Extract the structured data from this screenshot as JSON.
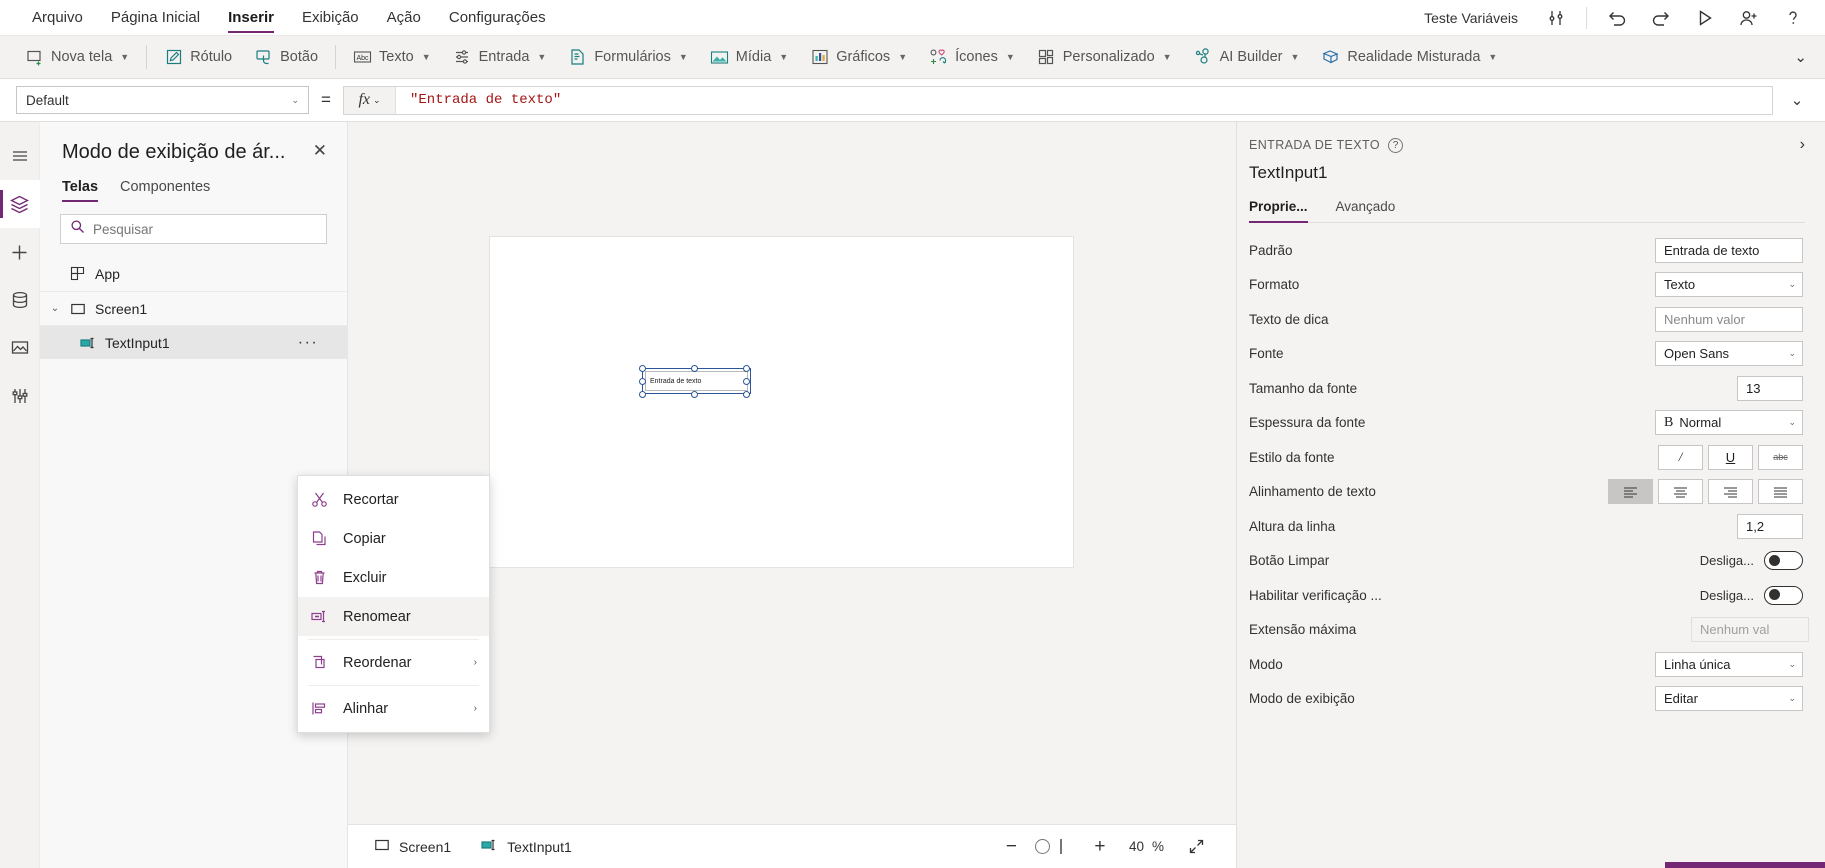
{
  "menubar": {
    "items": [
      {
        "label": "Arquivo",
        "active": false
      },
      {
        "label": "Página Inicial",
        "active": false
      },
      {
        "label": "Inserir",
        "active": true
      },
      {
        "label": "Exibição",
        "active": false
      },
      {
        "label": "Ação",
        "active": false
      },
      {
        "label": "Configurações",
        "active": false
      }
    ],
    "variables_test": "Teste Variáveis",
    "icons": [
      "settings-sliders-icon",
      "undo-icon",
      "redo-icon",
      "play-icon",
      "share-user-icon",
      "help-icon"
    ]
  },
  "ribbon": {
    "items": [
      {
        "label": "Nova tela",
        "icon": "new-screen-icon",
        "caret": true
      },
      {
        "label": "Rótulo",
        "icon": "label-icon",
        "caret": false
      },
      {
        "label": "Botão",
        "icon": "button-icon",
        "caret": false
      },
      {
        "label": "Texto",
        "icon": "text-abc-icon",
        "caret": true
      },
      {
        "label": "Entrada",
        "icon": "input-sliders-icon",
        "caret": true
      },
      {
        "label": "Formulários",
        "icon": "forms-icon",
        "caret": true
      },
      {
        "label": "Mídia",
        "icon": "media-image-icon",
        "caret": true
      },
      {
        "label": "Gráficos",
        "icon": "charts-bar-icon",
        "caret": true
      },
      {
        "label": "Ícones",
        "icon": "icons-shapes-icon",
        "caret": true
      },
      {
        "label": "Personalizado",
        "icon": "custom-grid-icon",
        "caret": true
      },
      {
        "label": "AI Builder",
        "icon": "ai-builder-icon",
        "caret": true
      },
      {
        "label": "Realidade Misturada",
        "icon": "mixed-reality-icon",
        "caret": true
      }
    ],
    "overflow": "chevron-down-icon"
  },
  "formulabar": {
    "property": "Default",
    "equals": "=",
    "fx_label": "fx",
    "formula": "\"Entrada de texto\""
  },
  "rail": {
    "items": [
      {
        "icon": "hamburger-menu-icon",
        "selected": false
      },
      {
        "icon": "tree-view-layers-icon",
        "selected": true
      },
      {
        "icon": "insert-plus-icon",
        "selected": false
      },
      {
        "icon": "data-cylinder-icon",
        "selected": false
      },
      {
        "icon": "media-library-icon",
        "selected": false
      },
      {
        "icon": "advanced-tools-icon",
        "selected": false
      }
    ]
  },
  "treepanel": {
    "title": "Modo de exibição de ár...",
    "close_icon": "close-icon",
    "tabs": [
      {
        "label": "Telas",
        "active": true
      },
      {
        "label": "Componentes",
        "active": false
      }
    ],
    "search": {
      "placeholder": "Pesquisar",
      "value": "",
      "icon": "search-icon"
    },
    "items": [
      {
        "label": "App",
        "icon": "app-grid-icon",
        "indent": 1,
        "chevron": "",
        "selected": false,
        "dots": false
      },
      {
        "label": "Screen1",
        "icon": "screen-rect-icon",
        "indent": 1,
        "chevron": "⌄",
        "selected": false,
        "dots": false
      },
      {
        "label": "TextInput1",
        "icon": "text-input-icon",
        "indent": 2,
        "chevron": "",
        "selected": true,
        "dots": true
      }
    ]
  },
  "contextmenu": {
    "items": [
      {
        "label": "Recortar",
        "icon": "scissors-icon",
        "submenu": false,
        "highlighted": false,
        "divider_after": false
      },
      {
        "label": "Copiar",
        "icon": "copy-icon",
        "submenu": false,
        "highlighted": false,
        "divider_after": false
      },
      {
        "label": "Excluir",
        "icon": "trash-icon",
        "submenu": false,
        "highlighted": false,
        "divider_after": false
      },
      {
        "label": "Renomear",
        "icon": "rename-icon",
        "submenu": false,
        "highlighted": true,
        "divider_after": true
      },
      {
        "label": "Reordenar",
        "icon": "reorder-icon",
        "submenu": true,
        "highlighted": false,
        "divider_after": true
      },
      {
        "label": "Alinhar",
        "icon": "align-icon",
        "submenu": true,
        "highlighted": false,
        "divider_after": false
      }
    ],
    "submenu_arrow": "›"
  },
  "canvas": {
    "textinput_value": "Entrada de texto"
  },
  "statusbar": {
    "screen_chip": {
      "label": "Screen1",
      "icon": "screen-rect-icon"
    },
    "control_chip": {
      "label": "TextInput1",
      "icon": "text-input-icon"
    },
    "zoom_out": "−",
    "zoom_in": "+",
    "zoom_value": "40",
    "zoom_unit": "%",
    "fullscreen_icon": "expand-arrows-icon"
  },
  "properties": {
    "kicker": "ENTRADA DE TEXTO",
    "help_icon": "help-circle-icon",
    "expand_icon": "chevron-right-icon",
    "control_name": "TextInput1",
    "tabs": [
      {
        "label": "Proprie...",
        "active": true
      },
      {
        "label": "Avançado",
        "active": false
      }
    ],
    "rows": [
      {
        "label": "Padrão",
        "type": "text",
        "value": "Entrada de texto",
        "placeholder": false
      },
      {
        "label": "Formato",
        "type": "select",
        "value": "Texto"
      },
      {
        "label": "Texto de dica",
        "type": "text",
        "value": "Nenhum valor",
        "placeholder": true
      },
      {
        "label": "Fonte",
        "type": "select",
        "value": "Open Sans"
      },
      {
        "label": "Tamanho da fonte",
        "type": "number",
        "value": "13"
      },
      {
        "label": "Espessura da fonte",
        "type": "select-bold",
        "value": "Normal",
        "prefix": "B"
      },
      {
        "label": "Estilo da fonte",
        "type": "buttons",
        "buttons": [
          "italic-icon",
          "underline-icon",
          "strikethrough-icon"
        ],
        "active": -1
      },
      {
        "label": "Alinhamento de texto",
        "type": "buttons",
        "buttons": [
          "align-left-icon",
          "align-center-icon",
          "align-right-icon",
          "align-justify-icon"
        ],
        "active": 0
      },
      {
        "label": "Altura da linha",
        "type": "number",
        "value": "1,2"
      },
      {
        "label": "Botão Limpar",
        "type": "toggle",
        "value": "Desliga...",
        "on": false
      },
      {
        "label": "Habilitar verificação ...",
        "type": "toggle",
        "value": "Desliga...",
        "on": false
      },
      {
        "label": "Extensão máxima",
        "type": "text-disabled",
        "value": "Nenhum val",
        "placeholder": true
      },
      {
        "label": "Modo",
        "type": "select",
        "value": "Linha única"
      },
      {
        "label": "Modo de exibição",
        "type": "select",
        "value": "Editar"
      }
    ]
  },
  "colors": {
    "accent_purple": "#742774",
    "teal_icon": "#1a7e7e",
    "formula_string": "#a31515",
    "selection_blue": "#2b579a",
    "panel_bg": "#f4f3f2"
  }
}
